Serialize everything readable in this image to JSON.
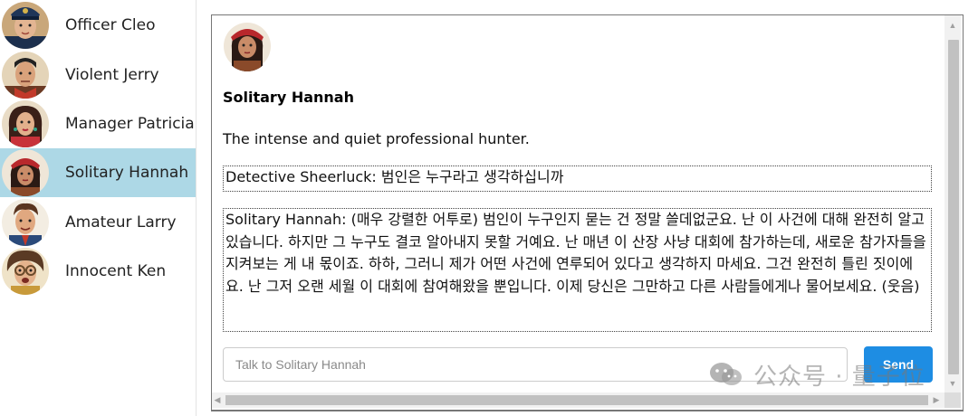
{
  "sidebar": {
    "items": [
      {
        "label": "Officer Cleo",
        "active": false,
        "avatar": "officer-cleo-avatar"
      },
      {
        "label": "Violent Jerry",
        "active": false,
        "avatar": "violent-jerry-avatar"
      },
      {
        "label": "Manager Patricia",
        "active": false,
        "avatar": "manager-patricia-avatar"
      },
      {
        "label": "Solitary Hannah",
        "active": true,
        "avatar": "solitary-hannah-avatar"
      },
      {
        "label": "Amateur Larry",
        "active": false,
        "avatar": "amateur-larry-avatar"
      },
      {
        "label": "Innocent Ken",
        "active": false,
        "avatar": "innocent-ken-avatar"
      }
    ],
    "active_color": "#add8e6"
  },
  "character": {
    "name": "Solitary Hannah",
    "description": "The intense and quiet professional hunter."
  },
  "conversation": [
    {
      "text": "Detective Sheerluck: 범인은 누구라고 생각하십니까"
    },
    {
      "text": "Solitary Hannah: (매우 강렬한 어투로) 범인이 누구인지 묻는 건 정말 쓸데없군요. 난 이 사건에 대해 완전히 알고 있습니다. 하지만 그 누구도 결코 알아내지 못할 거예요. 난 매년 이 산장 사냥 대회에 참가하는데, 새로운 참가자들을 지켜보는 게 내 몫이죠. 하하, 그러니 제가 어떤 사건에 연루되어 있다고 생각하지 마세요. 그건 완전히 틀린 짓이에요. 난 그저 오랜 세월 이 대회에 참여해왔을 뿐입니다. 이제 당신은 그만하고 다른 사람들에게나 물어보세요. (웃음)"
    }
  ],
  "composer": {
    "placeholder": "Talk to Solitary Hannah",
    "value": "",
    "send_label": "Send",
    "send_color": "#1e8de3"
  },
  "watermark": {
    "text": "公众号 · 量子位",
    "icon": "wechat-icon"
  }
}
